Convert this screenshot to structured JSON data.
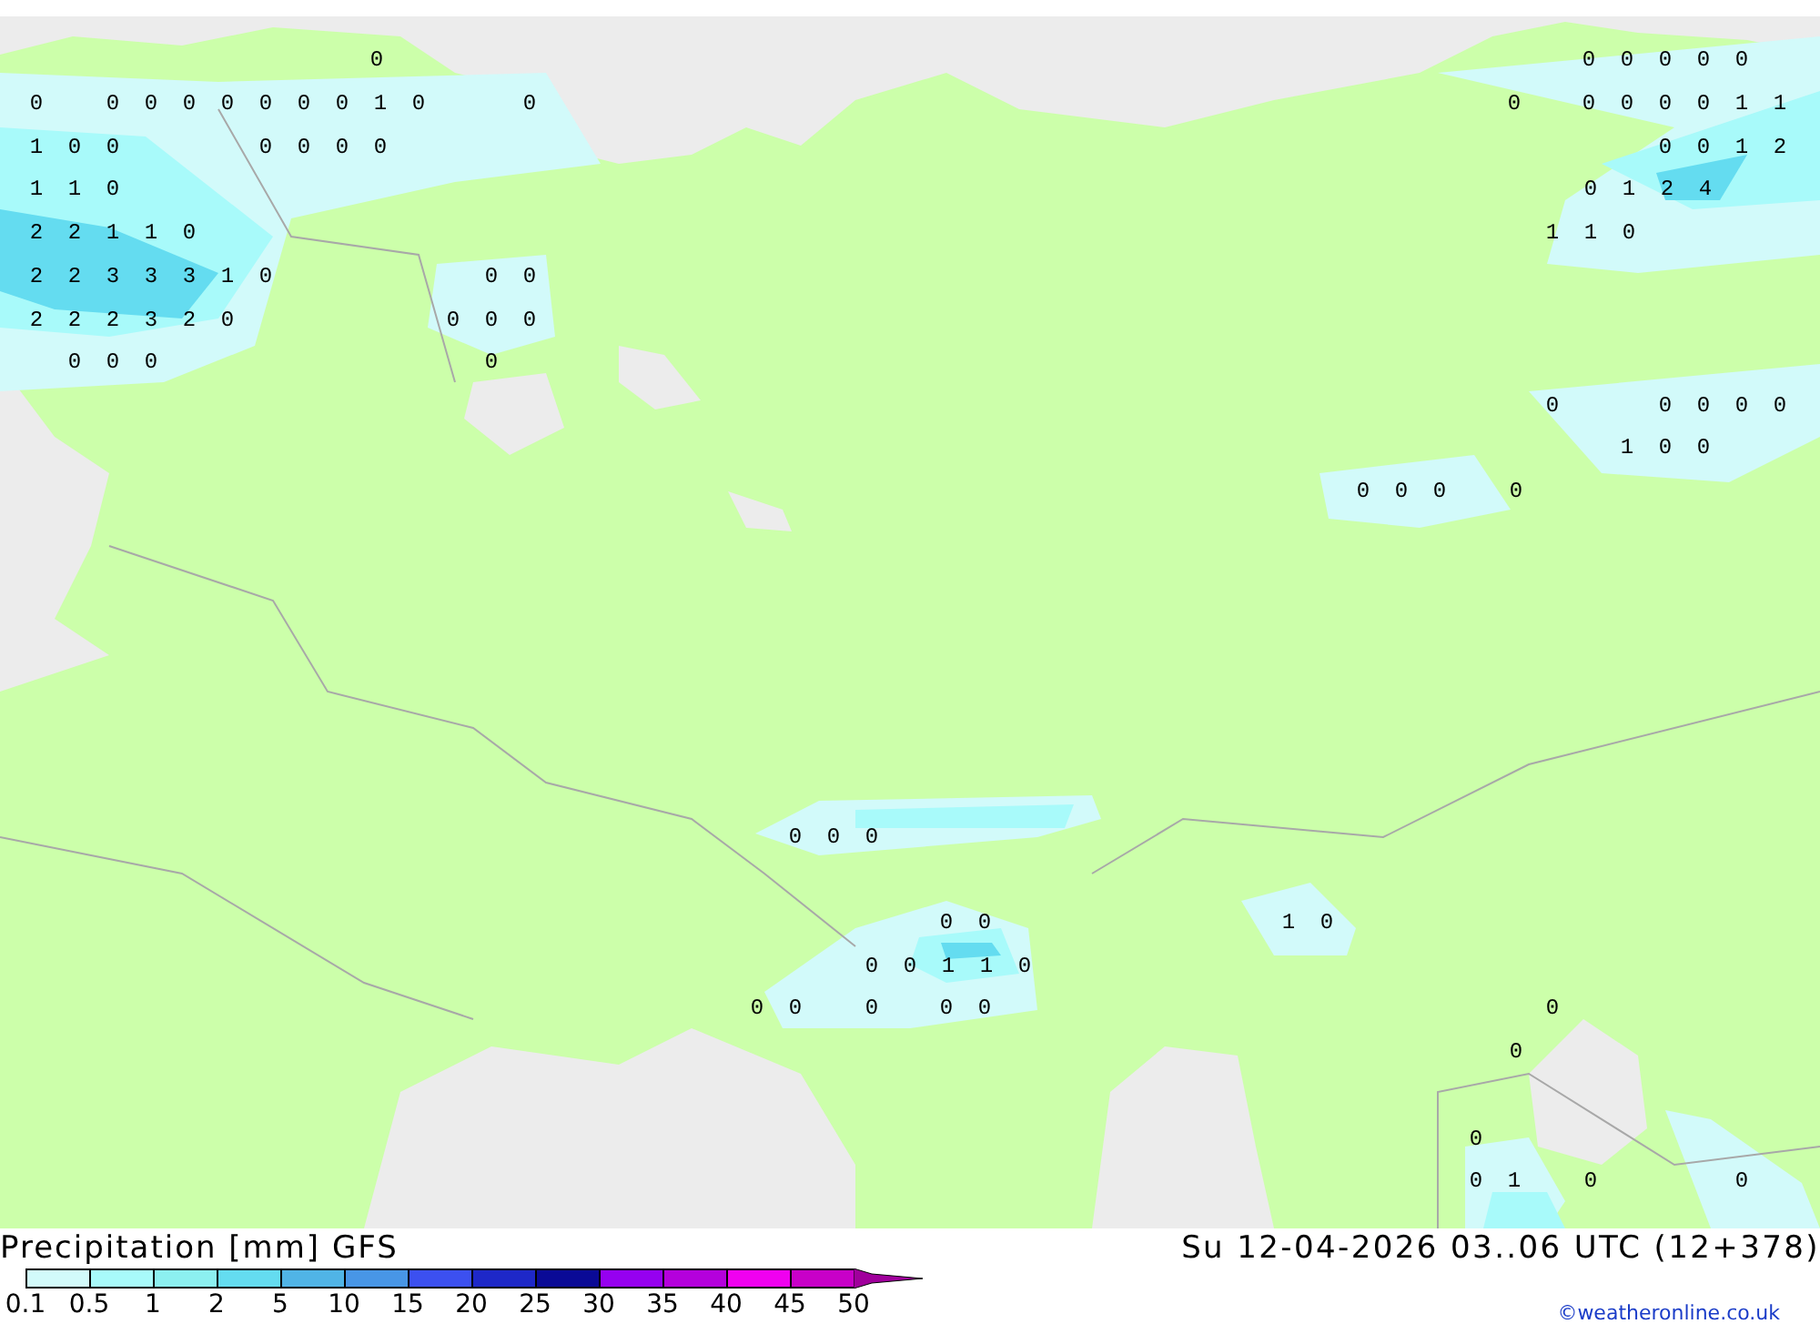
{
  "map": {
    "labels": [
      {
        "text": "0"
      },
      {
        "text": "0"
      },
      {
        "text": "0 0 0 0 0 0 0 1 0"
      },
      {
        "text": "0"
      },
      {
        "text": "1 0 0"
      },
      {
        "text": "0 0 0 0"
      },
      {
        "text": "1 1 0"
      },
      {
        "text": "2 2 1 1 0"
      },
      {
        "text": "2 2 3 3 3 1 0"
      },
      {
        "text": "0 0"
      },
      {
        "text": "2 2 2 3 2 0"
      },
      {
        "text": "0 0 0"
      },
      {
        "text": "0 0 0"
      },
      {
        "text": "0"
      },
      {
        "text": "0 0 0 0 0"
      },
      {
        "text": "0"
      },
      {
        "text": "0 0 0 0 1 1"
      },
      {
        "text": "0 0 1 2"
      },
      {
        "text": "0 1 2 4"
      },
      {
        "text": "1 1 0"
      },
      {
        "text": "0"
      },
      {
        "text": "0 0 0 0"
      },
      {
        "text": "1 0 0"
      },
      {
        "text": "0 0 0"
      },
      {
        "text": "0"
      },
      {
        "text": "0 0 0"
      },
      {
        "text": "0 0"
      },
      {
        "text": "1 0"
      },
      {
        "text": "0 0 1 1 0"
      },
      {
        "text": "0 0"
      },
      {
        "text": "0"
      },
      {
        "text": "0 0"
      },
      {
        "text": "0"
      },
      {
        "text": "0"
      },
      {
        "text": "0"
      },
      {
        "text": "0 1"
      },
      {
        "text": "0"
      },
      {
        "text": "0"
      }
    ]
  },
  "footer": {
    "title": "Precipitation [mm] GFS",
    "datetime": "Su 12-04-2026 03..06 UTC (12+378)",
    "credit": "©weatheronline.co.uk",
    "legend": [
      {
        "label": "0.1",
        "color": "#d2fafa"
      },
      {
        "label": "0.5",
        "color": "#a8fafa"
      },
      {
        "label": "1",
        "color": "#8cf0f0"
      },
      {
        "label": "2",
        "color": "#64dcf0"
      },
      {
        "label": "5",
        "color": "#50b4e6"
      },
      {
        "label": "10",
        "color": "#4896e6"
      },
      {
        "label": "15",
        "color": "#3c50f0"
      },
      {
        "label": "20",
        "color": "#1e28c8"
      },
      {
        "label": "25",
        "color": "#0a0a96"
      },
      {
        "label": "30",
        "color": "#9600f0"
      },
      {
        "label": "35",
        "color": "#b400dc"
      },
      {
        "label": "40",
        "color": "#f000f0"
      },
      {
        "label": "45",
        "color": "#c800c8"
      }
    ],
    "end_label": "50"
  }
}
